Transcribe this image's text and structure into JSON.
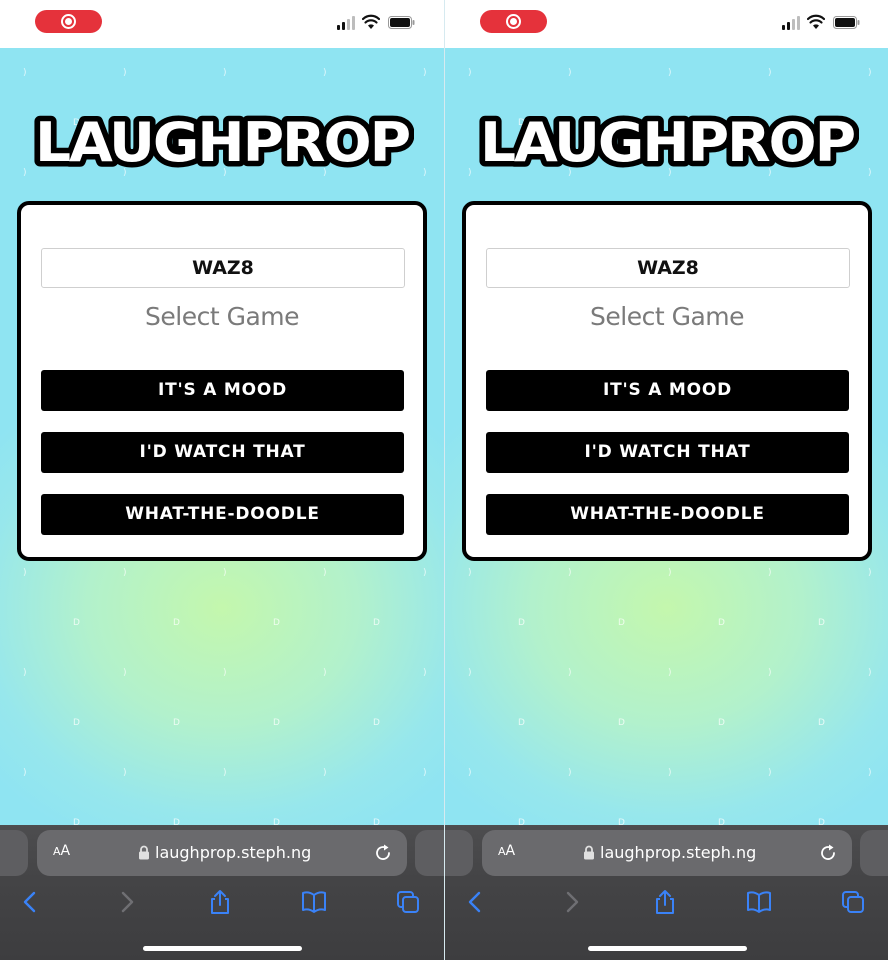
{
  "app": {
    "logo_text": "LAUGHPROP",
    "room_code": "WAZ8",
    "select_title": "Select Game",
    "games": [
      {
        "label": "IT'S A MOOD"
      },
      {
        "label": "I'D WATCH THAT"
      },
      {
        "label": "WHAT-THE-DOODLE"
      }
    ]
  },
  "browser": {
    "aa_large": "A",
    "aa_small": "A",
    "url": "laughprop.steph.ng",
    "icons": [
      "back-icon",
      "forward-icon",
      "share-icon",
      "bookmarks-icon",
      "tabs-icon",
      "reload-icon",
      "lock-icon"
    ]
  },
  "status_bar": {
    "icons": [
      "screen-recording-icon",
      "cellular-signal-icon",
      "wifi-icon",
      "battery-icon"
    ]
  },
  "colors": {
    "record_red": "#e5323b",
    "page_cyan": "#8fe4f2",
    "page_green": "#c4f7ad",
    "card_border": "#000000",
    "button_bg": "#000000",
    "toolbar_blue": "#3a82f7"
  }
}
